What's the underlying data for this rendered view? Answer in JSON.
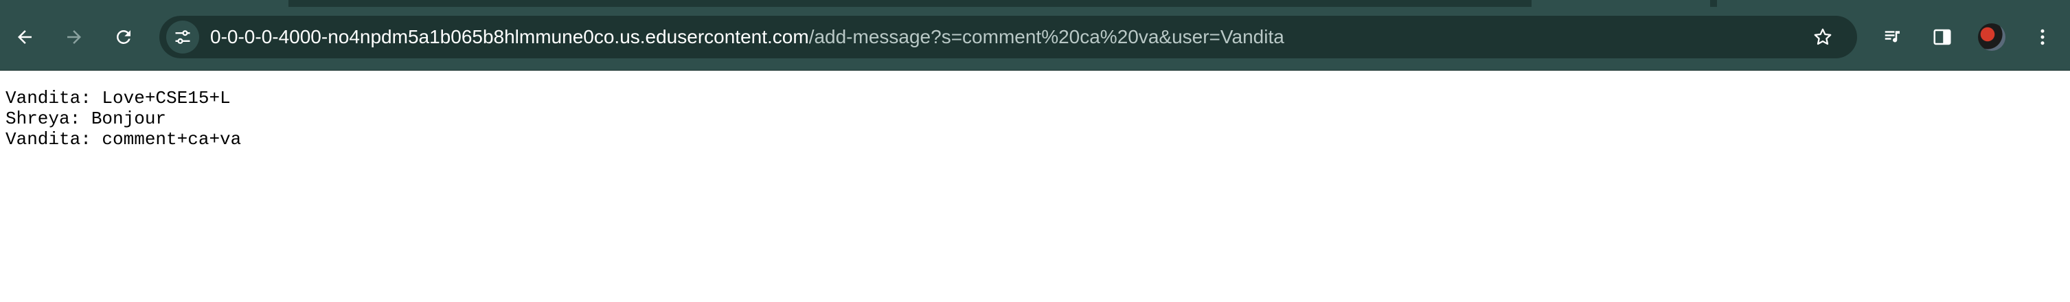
{
  "browser": {
    "theme_color": "#2f4f4c",
    "address_bar": {
      "host": "0-0-0-0-4000-no4npdm5a1b065b8hlmmune0co.us.edusercontent.com",
      "path": "/add-message?s=comment%20ca%20va&user=Vandita"
    },
    "icons": {
      "back": "back-arrow-icon",
      "forward": "forward-arrow-icon",
      "reload": "reload-icon",
      "site_info": "tune-icon",
      "bookmark": "star-icon",
      "media": "playlist-icon",
      "side_panel": "side-panel-icon",
      "profile": "avatar",
      "menu": "kebab-menu-icon"
    }
  },
  "page": {
    "lines": [
      "Vandita: Love+CSE15+L",
      "Shreya: Bonjour",
      "Vandita: comment+ca+va"
    ]
  }
}
